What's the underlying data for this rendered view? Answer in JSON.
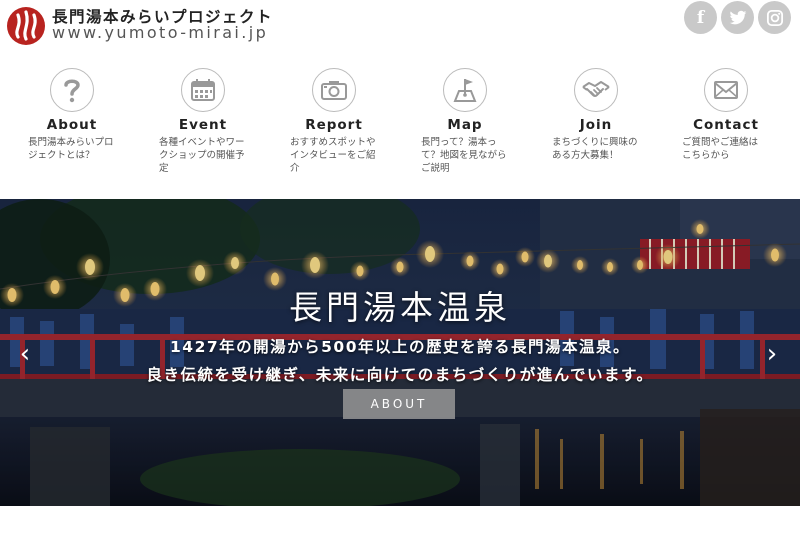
{
  "brand": {
    "title": "長門湯本みらいプロジェクト",
    "url": "www.yumoto-mirai.jp",
    "accent_color": "#b8231f"
  },
  "social": [
    {
      "name": "facebook-icon",
      "glyph": "f"
    },
    {
      "name": "twitter-icon",
      "glyph": "🐦"
    },
    {
      "name": "instagram-icon",
      "glyph": "◎"
    }
  ],
  "nav": [
    {
      "label": "About",
      "desc": "長門湯本みらいプロジェクトとは？",
      "icon": "question-icon"
    },
    {
      "label": "Event",
      "desc": "各種イベントやワークショップの開催予定",
      "icon": "calendar-icon"
    },
    {
      "label": "Report",
      "desc": "おすすめスポットやインタビューをご紹介",
      "icon": "camera-icon"
    },
    {
      "label": "Map",
      "desc": "長門って？湯本って？地図を見ながらご説明",
      "icon": "map-icon"
    },
    {
      "label": "Join",
      "desc": "まちづくりに興味のある方大募集！",
      "icon": "handshake-icon"
    },
    {
      "label": "Contact",
      "desc": "ご質問やご連絡は こちらから",
      "icon": "envelope-icon"
    }
  ],
  "hero": {
    "title": "長門湯本温泉",
    "line1": "1427年の開湯から500年以上の歴史を誇る長門湯本温泉。",
    "line2": "良き伝統を受け継ぎ、未来に向けてのまちづくりが進んでいます。",
    "button_label": "ABOUT",
    "prev": "‹",
    "next": "›"
  }
}
